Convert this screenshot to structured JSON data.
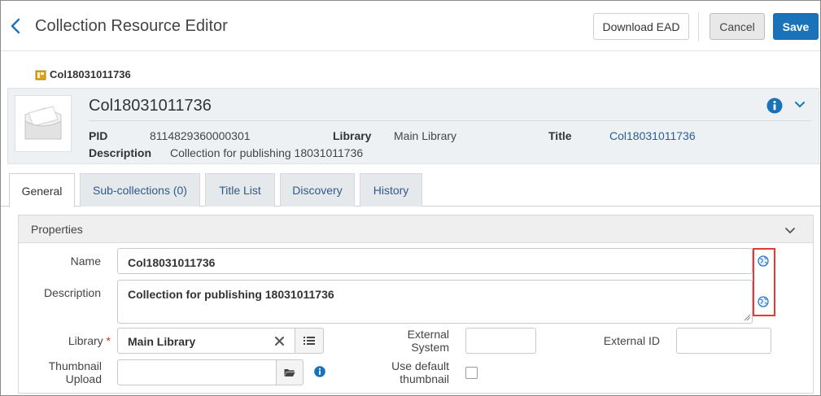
{
  "header": {
    "title": "Collection Resource Editor",
    "download_label": "Download EAD",
    "cancel_label": "Cancel",
    "save_label": "Save"
  },
  "breadcrumb": {
    "label": "Col18031011736"
  },
  "summary": {
    "title": "Col18031011736",
    "pid_label": "PID",
    "pid_value": "8114829360000301",
    "library_label": "Library",
    "library_value": "Main Library",
    "title_label": "Title",
    "title_value": "Col18031011736",
    "description_label": "Description",
    "description_value": "Collection for publishing 18031011736"
  },
  "tabs": [
    {
      "label": "General",
      "active": true
    },
    {
      "label": "Sub-collections (0)",
      "active": false
    },
    {
      "label": "Title List",
      "active": false
    },
    {
      "label": "Discovery",
      "active": false
    },
    {
      "label": "History",
      "active": false
    }
  ],
  "properties": {
    "title": "Properties",
    "name_label": "Name",
    "name_value": "Col18031011736",
    "description_label": "Description",
    "description_value": "Collection for publishing 18031011736",
    "library_label": "Library",
    "library_required": "*",
    "library_value": "Main Library",
    "external_system_label_1": "External",
    "external_system_label_2": "System",
    "external_system_value": "",
    "external_id_label": "External ID",
    "external_id_value": "",
    "thumbnail_label_1": "Thumbnail",
    "thumbnail_label_2": "Upload",
    "thumbnail_value": "",
    "use_default_label_1": "Use default",
    "use_default_label_2": "thumbnail",
    "use_default_checked": false
  },
  "colors": {
    "accent": "#1a73b8",
    "link": "#2a5d93",
    "highlight": "#e53935",
    "required": "#c0392b"
  }
}
